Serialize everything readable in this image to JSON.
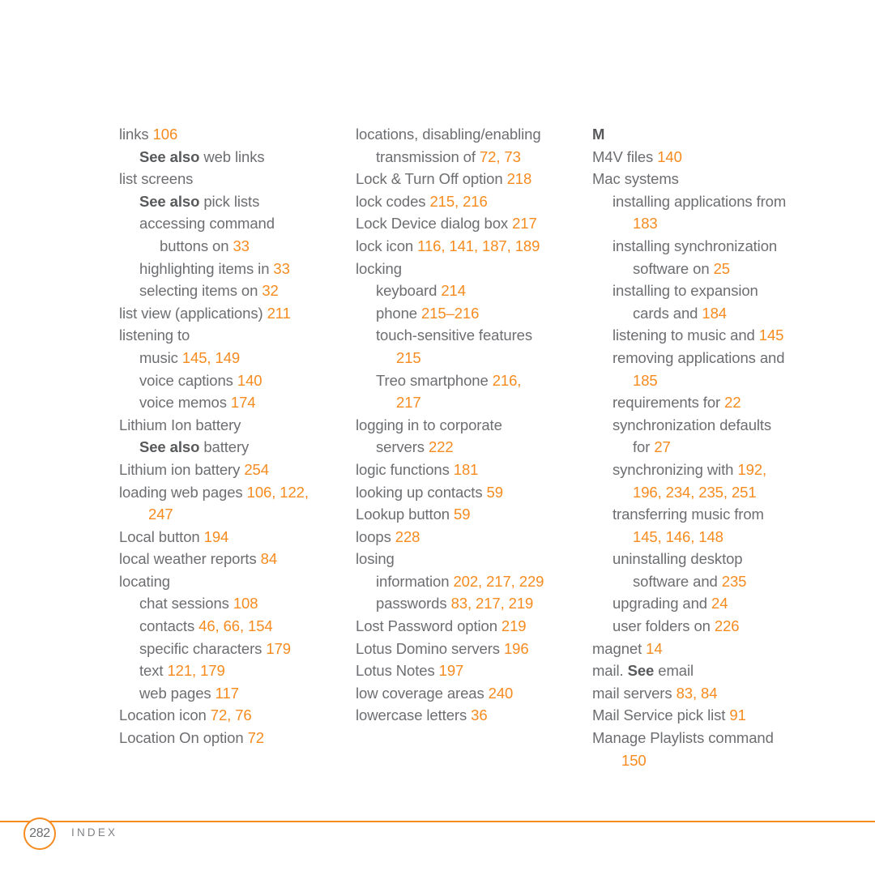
{
  "document": {
    "type": "book-index-page",
    "page_number": "282",
    "running_footer": "INDEX"
  },
  "colors": {
    "accent": "#f68b1f",
    "body_text": "#6d6e71",
    "heading_text": "#58595b",
    "background": "#ffffff"
  },
  "columns": [
    {
      "id": "column-1",
      "entries": [
        {
          "level": 0,
          "parts": [
            {
              "t": "links ",
              "k": "n"
            },
            {
              "t": "106",
              "k": "p"
            }
          ]
        },
        {
          "level": 1,
          "parts": [
            {
              "t": "See also",
              "k": "x"
            },
            {
              "t": " web links",
              "k": "n"
            }
          ]
        },
        {
          "level": 0,
          "parts": [
            {
              "t": "list screens",
              "k": "n"
            }
          ]
        },
        {
          "level": 1,
          "parts": [
            {
              "t": "See also",
              "k": "x"
            },
            {
              "t": " pick lists",
              "k": "n"
            }
          ]
        },
        {
          "level": 1,
          "parts": [
            {
              "t": "accessing command",
              "k": "n"
            }
          ]
        },
        {
          "level": 2,
          "parts": [
            {
              "t": "buttons on ",
              "k": "n"
            },
            {
              "t": "33",
              "k": "p"
            }
          ]
        },
        {
          "level": 1,
          "parts": [
            {
              "t": "highlighting items in ",
              "k": "n"
            },
            {
              "t": "33",
              "k": "p"
            }
          ]
        },
        {
          "level": 1,
          "parts": [
            {
              "t": "selecting items on ",
              "k": "n"
            },
            {
              "t": "32",
              "k": "p"
            }
          ]
        },
        {
          "level": 0,
          "parts": [
            {
              "t": "list view (applications) ",
              "k": "n"
            },
            {
              "t": "211",
              "k": "p"
            }
          ]
        },
        {
          "level": 0,
          "parts": [
            {
              "t": "listening to",
              "k": "n"
            }
          ]
        },
        {
          "level": 1,
          "parts": [
            {
              "t": "music ",
              "k": "n"
            },
            {
              "t": "145, 149",
              "k": "p"
            }
          ]
        },
        {
          "level": 1,
          "parts": [
            {
              "t": "voice captions ",
              "k": "n"
            },
            {
              "t": "140",
              "k": "p"
            }
          ]
        },
        {
          "level": 1,
          "parts": [
            {
              "t": "voice memos ",
              "k": "n"
            },
            {
              "t": "174",
              "k": "p"
            }
          ]
        },
        {
          "level": 0,
          "parts": [
            {
              "t": "Lithium Ion battery",
              "k": "n"
            }
          ]
        },
        {
          "level": 1,
          "parts": [
            {
              "t": "See also",
              "k": "x"
            },
            {
              "t": " battery",
              "k": "n"
            }
          ]
        },
        {
          "level": 0,
          "parts": [
            {
              "t": "Lithium ion battery ",
              "k": "n"
            },
            {
              "t": "254",
              "k": "p"
            }
          ]
        },
        {
          "level": 0,
          "parts": [
            {
              "t": "loading web pages ",
              "k": "n"
            },
            {
              "t": "106, 122,",
              "k": "p"
            }
          ]
        },
        {
          "level": 3,
          "parts": [
            {
              "t": "247",
              "k": "p"
            }
          ]
        },
        {
          "level": 0,
          "parts": [
            {
              "t": "Local button ",
              "k": "n"
            },
            {
              "t": "194",
              "k": "p"
            }
          ]
        },
        {
          "level": 0,
          "parts": [
            {
              "t": "local weather reports ",
              "k": "n"
            },
            {
              "t": "84",
              "k": "p"
            }
          ]
        },
        {
          "level": 0,
          "parts": [
            {
              "t": "locating",
              "k": "n"
            }
          ]
        },
        {
          "level": 1,
          "parts": [
            {
              "t": "chat sessions ",
              "k": "n"
            },
            {
              "t": "108",
              "k": "p"
            }
          ]
        },
        {
          "level": 1,
          "parts": [
            {
              "t": "contacts ",
              "k": "n"
            },
            {
              "t": "46, 66, 154",
              "k": "p"
            }
          ]
        },
        {
          "level": 1,
          "parts": [
            {
              "t": "specific characters ",
              "k": "n"
            },
            {
              "t": "179",
              "k": "p"
            }
          ]
        },
        {
          "level": 1,
          "parts": [
            {
              "t": "text ",
              "k": "n"
            },
            {
              "t": "121, 179",
              "k": "p"
            }
          ]
        },
        {
          "level": 1,
          "parts": [
            {
              "t": "web pages ",
              "k": "n"
            },
            {
              "t": "117",
              "k": "p"
            }
          ]
        },
        {
          "level": 0,
          "parts": [
            {
              "t": "Location icon ",
              "k": "n"
            },
            {
              "t": "72, 76",
              "k": "p"
            }
          ]
        },
        {
          "level": 0,
          "parts": [
            {
              "t": "Location On option ",
              "k": "n"
            },
            {
              "t": "72",
              "k": "p"
            }
          ]
        }
      ]
    },
    {
      "id": "column-2",
      "entries": [
        {
          "level": 0,
          "parts": [
            {
              "t": "locations, disabling/enabling",
              "k": "n"
            }
          ]
        },
        {
          "level": 1,
          "parts": [
            {
              "t": "transmission of ",
              "k": "n"
            },
            {
              "t": "72, 73",
              "k": "p"
            }
          ]
        },
        {
          "level": 0,
          "parts": [
            {
              "t": "Lock & Turn Off option ",
              "k": "n"
            },
            {
              "t": "218",
              "k": "p"
            }
          ]
        },
        {
          "level": 0,
          "parts": [
            {
              "t": "lock codes ",
              "k": "n"
            },
            {
              "t": "215, 216",
              "k": "p"
            }
          ]
        },
        {
          "level": 0,
          "parts": [
            {
              "t": "Lock Device dialog box ",
              "k": "n"
            },
            {
              "t": "217",
              "k": "p"
            }
          ]
        },
        {
          "level": 0,
          "parts": [
            {
              "t": "lock icon ",
              "k": "n"
            },
            {
              "t": "116, 141, 187, 189",
              "k": "p"
            }
          ]
        },
        {
          "level": 0,
          "parts": [
            {
              "t": "locking",
              "k": "n"
            }
          ]
        },
        {
          "level": 1,
          "parts": [
            {
              "t": "keyboard ",
              "k": "n"
            },
            {
              "t": "214",
              "k": "p"
            }
          ]
        },
        {
          "level": 1,
          "parts": [
            {
              "t": "phone ",
              "k": "n"
            },
            {
              "t": "215–216",
              "k": "p"
            }
          ]
        },
        {
          "level": 1,
          "parts": [
            {
              "t": "touch-sensitive features",
              "k": "n"
            }
          ]
        },
        {
          "level": 2,
          "parts": [
            {
              "t": "215",
              "k": "p"
            }
          ]
        },
        {
          "level": 1,
          "parts": [
            {
              "t": "Treo smartphone ",
              "k": "n"
            },
            {
              "t": "216,",
              "k": "p"
            }
          ]
        },
        {
          "level": 2,
          "parts": [
            {
              "t": "217",
              "k": "p"
            }
          ]
        },
        {
          "level": 0,
          "parts": [
            {
              "t": "logging in to corporate",
              "k": "n"
            }
          ]
        },
        {
          "level": 1,
          "parts": [
            {
              "t": "servers ",
              "k": "n"
            },
            {
              "t": "222",
              "k": "p"
            }
          ]
        },
        {
          "level": 0,
          "parts": [
            {
              "t": "logic functions ",
              "k": "n"
            },
            {
              "t": "181",
              "k": "p"
            }
          ]
        },
        {
          "level": 0,
          "parts": [
            {
              "t": "looking up contacts ",
              "k": "n"
            },
            {
              "t": "59",
              "k": "p"
            }
          ]
        },
        {
          "level": 0,
          "parts": [
            {
              "t": "Lookup button ",
              "k": "n"
            },
            {
              "t": "59",
              "k": "p"
            }
          ]
        },
        {
          "level": 0,
          "parts": [
            {
              "t": "loops ",
              "k": "n"
            },
            {
              "t": "228",
              "k": "p"
            }
          ]
        },
        {
          "level": 0,
          "parts": [
            {
              "t": "losing",
              "k": "n"
            }
          ]
        },
        {
          "level": 1,
          "parts": [
            {
              "t": "information ",
              "k": "n"
            },
            {
              "t": "202, 217, 229",
              "k": "p"
            }
          ]
        },
        {
          "level": 1,
          "parts": [
            {
              "t": "passwords ",
              "k": "n"
            },
            {
              "t": "83, 217, 219",
              "k": "p"
            }
          ]
        },
        {
          "level": 0,
          "parts": [
            {
              "t": "Lost Password option ",
              "k": "n"
            },
            {
              "t": "219",
              "k": "p"
            }
          ]
        },
        {
          "level": 0,
          "parts": [
            {
              "t": "Lotus Domino servers ",
              "k": "n"
            },
            {
              "t": "196",
              "k": "p"
            }
          ]
        },
        {
          "level": 0,
          "parts": [
            {
              "t": "Lotus Notes ",
              "k": "n"
            },
            {
              "t": "197",
              "k": "p"
            }
          ]
        },
        {
          "level": 0,
          "parts": [
            {
              "t": "low coverage areas ",
              "k": "n"
            },
            {
              "t": "240",
              "k": "p"
            }
          ]
        },
        {
          "level": 0,
          "parts": [
            {
              "t": "lowercase letters ",
              "k": "n"
            },
            {
              "t": "36",
              "k": "p"
            }
          ]
        }
      ]
    },
    {
      "id": "column-3",
      "heading": "M",
      "entries": [
        {
          "level": 0,
          "parts": [
            {
              "t": "M4V files ",
              "k": "n"
            },
            {
              "t": "140",
              "k": "p"
            }
          ]
        },
        {
          "level": 0,
          "parts": [
            {
              "t": "Mac systems",
              "k": "n"
            }
          ]
        },
        {
          "level": 1,
          "parts": [
            {
              "t": "installing applications from",
              "k": "n"
            }
          ]
        },
        {
          "level": 2,
          "parts": [
            {
              "t": "183",
              "k": "p"
            }
          ]
        },
        {
          "level": 1,
          "parts": [
            {
              "t": "installing synchronization",
              "k": "n"
            }
          ]
        },
        {
          "level": 2,
          "parts": [
            {
              "t": "software on ",
              "k": "n"
            },
            {
              "t": "25",
              "k": "p"
            }
          ]
        },
        {
          "level": 1,
          "parts": [
            {
              "t": "installing to expansion",
              "k": "n"
            }
          ]
        },
        {
          "level": 2,
          "parts": [
            {
              "t": "cards and ",
              "k": "n"
            },
            {
              "t": "184",
              "k": "p"
            }
          ]
        },
        {
          "level": 1,
          "parts": [
            {
              "t": "listening to music and ",
              "k": "n"
            },
            {
              "t": "145",
              "k": "p"
            }
          ]
        },
        {
          "level": 1,
          "parts": [
            {
              "t": "removing applications and",
              "k": "n"
            }
          ]
        },
        {
          "level": 2,
          "parts": [
            {
              "t": "185",
              "k": "p"
            }
          ]
        },
        {
          "level": 1,
          "parts": [
            {
              "t": "requirements for ",
              "k": "n"
            },
            {
              "t": "22",
              "k": "p"
            }
          ]
        },
        {
          "level": 1,
          "parts": [
            {
              "t": "synchronization defaults",
              "k": "n"
            }
          ]
        },
        {
          "level": 2,
          "parts": [
            {
              "t": "for ",
              "k": "n"
            },
            {
              "t": "27",
              "k": "p"
            }
          ]
        },
        {
          "level": 1,
          "parts": [
            {
              "t": "synchronizing with ",
              "k": "n"
            },
            {
              "t": "192,",
              "k": "p"
            }
          ]
        },
        {
          "level": 2,
          "parts": [
            {
              "t": "196, 234, 235, 251",
              "k": "p"
            }
          ]
        },
        {
          "level": 1,
          "parts": [
            {
              "t": "transferring music from",
              "k": "n"
            }
          ]
        },
        {
          "level": 2,
          "parts": [
            {
              "t": "145, 146, 148",
              "k": "p"
            }
          ]
        },
        {
          "level": 1,
          "parts": [
            {
              "t": "uninstalling desktop",
              "k": "n"
            }
          ]
        },
        {
          "level": 2,
          "parts": [
            {
              "t": "software and ",
              "k": "n"
            },
            {
              "t": "235",
              "k": "p"
            }
          ]
        },
        {
          "level": 1,
          "parts": [
            {
              "t": "upgrading and ",
              "k": "n"
            },
            {
              "t": "24",
              "k": "p"
            }
          ]
        },
        {
          "level": 1,
          "parts": [
            {
              "t": "user folders on ",
              "k": "n"
            },
            {
              "t": "226",
              "k": "p"
            }
          ]
        },
        {
          "level": 0,
          "parts": [
            {
              "t": "magnet ",
              "k": "n"
            },
            {
              "t": "14",
              "k": "p"
            }
          ]
        },
        {
          "level": 0,
          "parts": [
            {
              "t": "mail. ",
              "k": "n"
            },
            {
              "t": "See",
              "k": "x"
            },
            {
              "t": " email",
              "k": "n"
            }
          ]
        },
        {
          "level": 0,
          "parts": [
            {
              "t": "mail servers ",
              "k": "n"
            },
            {
              "t": "83, 84",
              "k": "p"
            }
          ]
        },
        {
          "level": 0,
          "parts": [
            {
              "t": "Mail Service pick list ",
              "k": "n"
            },
            {
              "t": "91",
              "k": "p"
            }
          ]
        },
        {
          "level": 0,
          "parts": [
            {
              "t": "Manage Playlists command",
              "k": "n"
            }
          ]
        },
        {
          "level": 3,
          "parts": [
            {
              "t": "150",
              "k": "p"
            }
          ]
        }
      ]
    }
  ]
}
